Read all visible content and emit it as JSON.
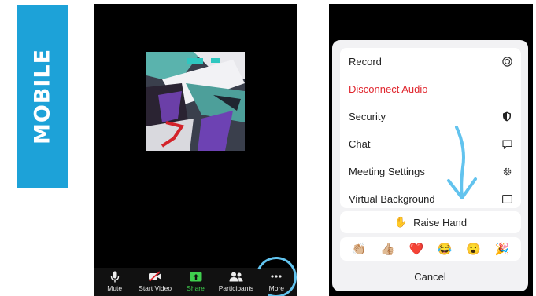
{
  "side_label": "MOBILE",
  "toolbar": [
    {
      "label": "Mute",
      "icon": "microphone-icon"
    },
    {
      "label": "Start Video",
      "icon": "video-off-icon"
    },
    {
      "label": "Share",
      "icon": "share-icon"
    },
    {
      "label": "Participants",
      "icon": "participants-icon"
    },
    {
      "label": "More",
      "icon": "more-icon"
    }
  ],
  "menu": [
    {
      "label": "Record",
      "icon": "record-icon"
    },
    {
      "label": "Disconnect Audio",
      "icon": ""
    },
    {
      "label": "Security",
      "icon": "shield-icon"
    },
    {
      "label": "Chat",
      "icon": "chat-icon"
    },
    {
      "label": "Meeting Settings",
      "icon": "gear-icon"
    },
    {
      "label": "Virtual Background",
      "icon": "image-icon"
    }
  ],
  "raise_hand": {
    "emoji": "✋",
    "label": "Raise Hand"
  },
  "reactions": [
    "👏🏼",
    "👍🏼",
    "❤️",
    "😂",
    "😮",
    "🎉"
  ],
  "cancel": "Cancel",
  "colors": {
    "accent": "#1da2d8",
    "danger": "#e0262e",
    "share_green": "#3fcf4e",
    "annotation": "#62c3ee"
  }
}
